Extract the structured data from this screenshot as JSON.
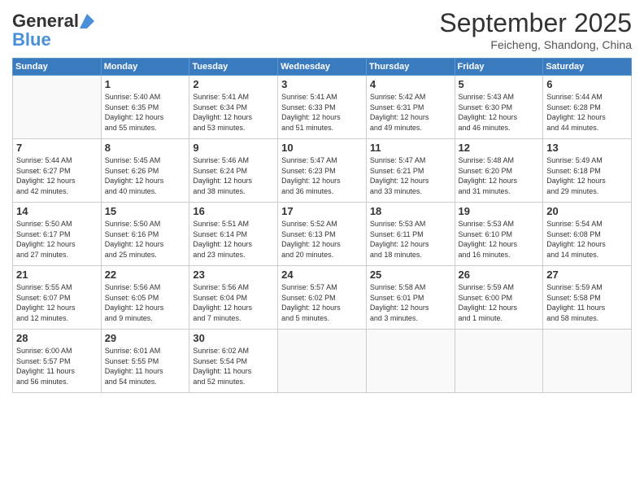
{
  "logo": {
    "line1": "General",
    "line2": "Blue"
  },
  "title": "September 2025",
  "location": "Feicheng, Shandong, China",
  "days_of_week": [
    "Sunday",
    "Monday",
    "Tuesday",
    "Wednesday",
    "Thursday",
    "Friday",
    "Saturday"
  ],
  "weeks": [
    [
      {
        "day": "",
        "info": ""
      },
      {
        "day": "1",
        "info": "Sunrise: 5:40 AM\nSunset: 6:35 PM\nDaylight: 12 hours\nand 55 minutes."
      },
      {
        "day": "2",
        "info": "Sunrise: 5:41 AM\nSunset: 6:34 PM\nDaylight: 12 hours\nand 53 minutes."
      },
      {
        "day": "3",
        "info": "Sunrise: 5:41 AM\nSunset: 6:33 PM\nDaylight: 12 hours\nand 51 minutes."
      },
      {
        "day": "4",
        "info": "Sunrise: 5:42 AM\nSunset: 6:31 PM\nDaylight: 12 hours\nand 49 minutes."
      },
      {
        "day": "5",
        "info": "Sunrise: 5:43 AM\nSunset: 6:30 PM\nDaylight: 12 hours\nand 46 minutes."
      },
      {
        "day": "6",
        "info": "Sunrise: 5:44 AM\nSunset: 6:28 PM\nDaylight: 12 hours\nand 44 minutes."
      }
    ],
    [
      {
        "day": "7",
        "info": "Sunrise: 5:44 AM\nSunset: 6:27 PM\nDaylight: 12 hours\nand 42 minutes."
      },
      {
        "day": "8",
        "info": "Sunrise: 5:45 AM\nSunset: 6:26 PM\nDaylight: 12 hours\nand 40 minutes."
      },
      {
        "day": "9",
        "info": "Sunrise: 5:46 AM\nSunset: 6:24 PM\nDaylight: 12 hours\nand 38 minutes."
      },
      {
        "day": "10",
        "info": "Sunrise: 5:47 AM\nSunset: 6:23 PM\nDaylight: 12 hours\nand 36 minutes."
      },
      {
        "day": "11",
        "info": "Sunrise: 5:47 AM\nSunset: 6:21 PM\nDaylight: 12 hours\nand 33 minutes."
      },
      {
        "day": "12",
        "info": "Sunrise: 5:48 AM\nSunset: 6:20 PM\nDaylight: 12 hours\nand 31 minutes."
      },
      {
        "day": "13",
        "info": "Sunrise: 5:49 AM\nSunset: 6:18 PM\nDaylight: 12 hours\nand 29 minutes."
      }
    ],
    [
      {
        "day": "14",
        "info": "Sunrise: 5:50 AM\nSunset: 6:17 PM\nDaylight: 12 hours\nand 27 minutes."
      },
      {
        "day": "15",
        "info": "Sunrise: 5:50 AM\nSunset: 6:16 PM\nDaylight: 12 hours\nand 25 minutes."
      },
      {
        "day": "16",
        "info": "Sunrise: 5:51 AM\nSunset: 6:14 PM\nDaylight: 12 hours\nand 23 minutes."
      },
      {
        "day": "17",
        "info": "Sunrise: 5:52 AM\nSunset: 6:13 PM\nDaylight: 12 hours\nand 20 minutes."
      },
      {
        "day": "18",
        "info": "Sunrise: 5:53 AM\nSunset: 6:11 PM\nDaylight: 12 hours\nand 18 minutes."
      },
      {
        "day": "19",
        "info": "Sunrise: 5:53 AM\nSunset: 6:10 PM\nDaylight: 12 hours\nand 16 minutes."
      },
      {
        "day": "20",
        "info": "Sunrise: 5:54 AM\nSunset: 6:08 PM\nDaylight: 12 hours\nand 14 minutes."
      }
    ],
    [
      {
        "day": "21",
        "info": "Sunrise: 5:55 AM\nSunset: 6:07 PM\nDaylight: 12 hours\nand 12 minutes."
      },
      {
        "day": "22",
        "info": "Sunrise: 5:56 AM\nSunset: 6:05 PM\nDaylight: 12 hours\nand 9 minutes."
      },
      {
        "day": "23",
        "info": "Sunrise: 5:56 AM\nSunset: 6:04 PM\nDaylight: 12 hours\nand 7 minutes."
      },
      {
        "day": "24",
        "info": "Sunrise: 5:57 AM\nSunset: 6:02 PM\nDaylight: 12 hours\nand 5 minutes."
      },
      {
        "day": "25",
        "info": "Sunrise: 5:58 AM\nSunset: 6:01 PM\nDaylight: 12 hours\nand 3 minutes."
      },
      {
        "day": "26",
        "info": "Sunrise: 5:59 AM\nSunset: 6:00 PM\nDaylight: 12 hours\nand 1 minute."
      },
      {
        "day": "27",
        "info": "Sunrise: 5:59 AM\nSunset: 5:58 PM\nDaylight: 11 hours\nand 58 minutes."
      }
    ],
    [
      {
        "day": "28",
        "info": "Sunrise: 6:00 AM\nSunset: 5:57 PM\nDaylight: 11 hours\nand 56 minutes."
      },
      {
        "day": "29",
        "info": "Sunrise: 6:01 AM\nSunset: 5:55 PM\nDaylight: 11 hours\nand 54 minutes."
      },
      {
        "day": "30",
        "info": "Sunrise: 6:02 AM\nSunset: 5:54 PM\nDaylight: 11 hours\nand 52 minutes."
      },
      {
        "day": "",
        "info": ""
      },
      {
        "day": "",
        "info": ""
      },
      {
        "day": "",
        "info": ""
      },
      {
        "day": "",
        "info": ""
      }
    ]
  ]
}
